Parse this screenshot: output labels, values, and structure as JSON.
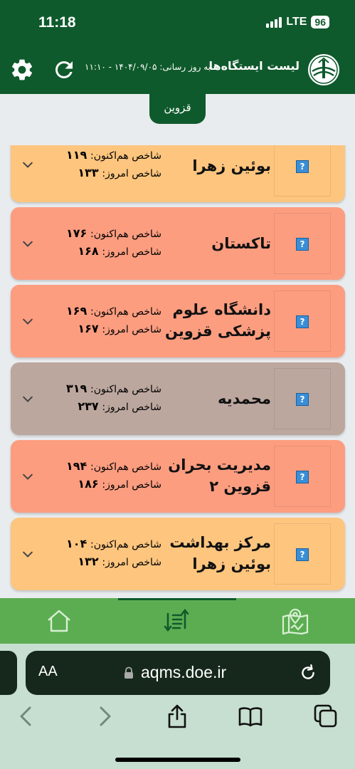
{
  "status_bar": {
    "time": "11:18",
    "network": "LTE",
    "battery": "96"
  },
  "header": {
    "title": "لیست ایستگاه‌ها",
    "updated_label": "به روز رسانی:",
    "updated_value": "۱۴۰۴/۰۹/۰۵ - ۱۱:۱۰"
  },
  "province_tab": "قزوین",
  "labels": {
    "now_index": "شاخص هم‌اکنون:",
    "today_index": "شاخص امروز:"
  },
  "stations": [
    {
      "name": "بوئین زهرا",
      "now": "۱۱۹",
      "today": "۱۳۳",
      "color": "#fdc57e"
    },
    {
      "name": "تاکستان",
      "now": "۱۷۶",
      "today": "۱۶۸",
      "color": "#fc9d80"
    },
    {
      "name": "دانشگاه علوم پزشکی قزوین",
      "now": "۱۶۹",
      "today": "۱۶۷",
      "color": "#fc9d80"
    },
    {
      "name": "محمدیه",
      "now": "۳۱۹",
      "today": "۲۳۷",
      "color": "#bca79e"
    },
    {
      "name": "مدیریت بحران قزوین ۲",
      "now": "۱۹۴",
      "today": "۱۸۶",
      "color": "#fc9d80"
    },
    {
      "name": "مرکز بهداشت بوئین زهرا",
      "now": "۱۰۴",
      "today": "۱۳۲",
      "color": "#fdc57e"
    }
  ],
  "bottom_nav": [
    "home-icon",
    "sort-list-icon",
    "map-location-icon"
  ],
  "browser": {
    "text_size_label": "AA",
    "url": "aqms.doe.ir"
  },
  "colors": {
    "brand": "#0f5a2c",
    "nav_bg": "#5cad52",
    "browser_bg": "#c6dfd0"
  }
}
